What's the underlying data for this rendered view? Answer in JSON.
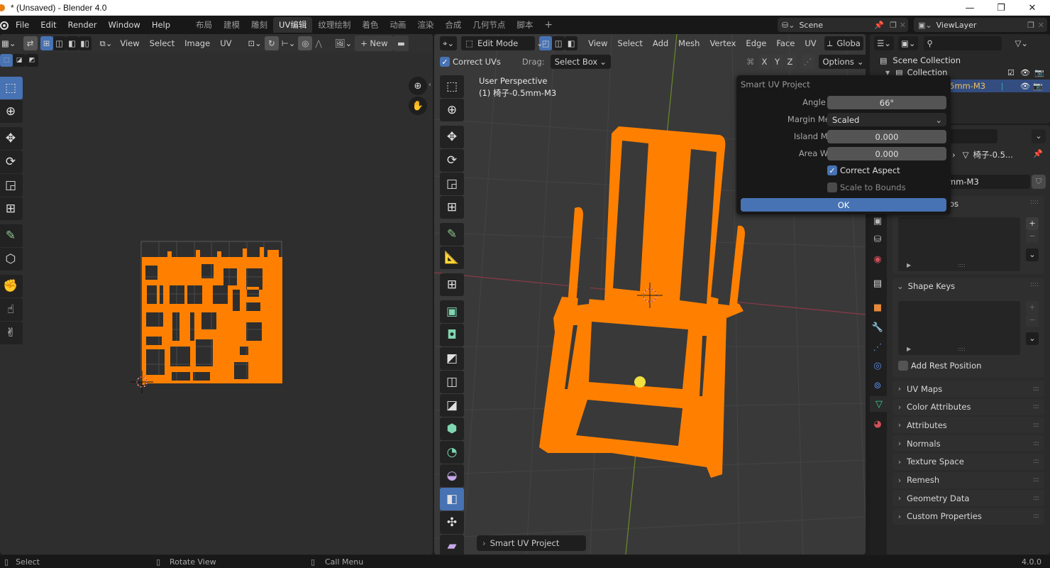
{
  "window": {
    "title": "* (Unsaved) - Blender 4.0",
    "controls": {
      "minimize": "—",
      "maximize": "❐",
      "close": "✕"
    }
  },
  "menubar": {
    "menus": [
      "File",
      "Edit",
      "Render",
      "Window",
      "Help"
    ],
    "workspaces": [
      "布局",
      "建模",
      "雕刻",
      "UV编辑",
      "纹理绘制",
      "着色",
      "动画",
      "渲染",
      "合成",
      "几何节点",
      "脚本"
    ],
    "active_workspace": "UV编辑",
    "add_workspace": "+",
    "scene": {
      "label": "Scene"
    },
    "view_layer": {
      "label": "ViewLayer"
    }
  },
  "uv_editor": {
    "header_menus": [
      "View",
      "Select",
      "Image",
      "UV"
    ],
    "new_button": "+ New",
    "tools": [
      "select-box",
      "cursor",
      "move",
      "rotate",
      "scale",
      "transform",
      "annotate",
      "rip",
      "grab",
      "relax",
      "pinch"
    ],
    "active_tool": "select-box",
    "uv_color": "#ff8000"
  },
  "viewport": {
    "mode": "Edit Mode",
    "header_menus": [
      "View",
      "Select",
      "Add",
      "Mesh",
      "Vertex",
      "Edge",
      "Face",
      "UV"
    ],
    "orientation": "Globa",
    "correct_uvs_label": "Correct UVs",
    "correct_uvs_checked": true,
    "drag_label": "Drag:",
    "drag_value": "Select Box",
    "axes": [
      "X",
      "Y",
      "Z"
    ],
    "options_label": "Options",
    "view_name": "User Perspective",
    "object_name": "(1) 椅子-0.5mm-M3",
    "last_operator": "Smart UV Project",
    "mesh_color": "#ff8000",
    "tools": [
      "select-box",
      "cursor",
      "move",
      "rotate",
      "scale",
      "transform",
      "annotate",
      "measure",
      "add-cube",
      "extrude",
      "inset",
      "bevel",
      "loop-cut",
      "knife",
      "poly-build",
      "spin",
      "smooth",
      "edge-slide",
      "shrink-fatten",
      "shear"
    ],
    "active_tool": "edge-slide"
  },
  "smart_uv_popup": {
    "title": "Smart UV Project",
    "fields": [
      {
        "label": "Angle Limit",
        "value": "66°"
      },
      {
        "label": "Margin Method",
        "value": "Scaled"
      },
      {
        "label": "Island Margin",
        "value": "0.000"
      },
      {
        "label": "Area Weight",
        "value": "0.000"
      }
    ],
    "correct_aspect": {
      "label": "Correct Aspect",
      "checked": true
    },
    "scale_to_bounds": {
      "label": "Scale to Bounds",
      "checked": false
    },
    "ok_label": "OK"
  },
  "outliner": {
    "scene_collection": "Scene Collection",
    "collection": "Collection",
    "object_suffix": "5mm-M3"
  },
  "properties": {
    "breadcrumb": "椅子-0.5...",
    "mesh_name": "mm-M3",
    "vertex_groups_partial": "os",
    "shape_keys": "Shape Keys",
    "add_rest_position": "Add Rest Position",
    "panels": [
      "UV Maps",
      "Color Attributes",
      "Attributes",
      "Normals",
      "Texture Space",
      "Remesh",
      "Geometry Data",
      "Custom Properties"
    ]
  },
  "statusbar": {
    "select": "Select",
    "rotate_view": "Rotate View",
    "call_menu": "Call Menu",
    "version": "4.0.0"
  }
}
